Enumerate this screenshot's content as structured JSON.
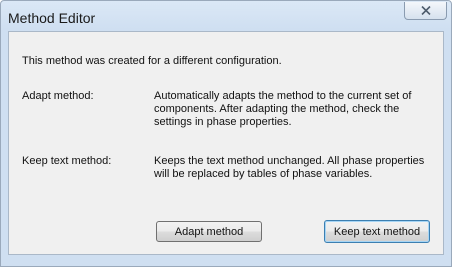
{
  "window": {
    "title": "Method Editor"
  },
  "dialog": {
    "intro": "This method was created for a different configuration.",
    "options": [
      {
        "label": "Adapt method:",
        "description": "Automatically adapts the method to the current set of components. After adapting the method, check the settings in phase properties."
      },
      {
        "label": "Keep text method:",
        "description": "Keeps the text method unchanged. All phase properties will be replaced by tables of phase variables."
      }
    ],
    "buttons": {
      "adapt": "Adapt method",
      "keep": "Keep text method"
    }
  },
  "icons": {
    "close": "close-icon"
  },
  "colors": {
    "title_bar": "#cfdff1",
    "client_bg": "#f0f0f0",
    "default_button_border": "#3c7fb1"
  }
}
